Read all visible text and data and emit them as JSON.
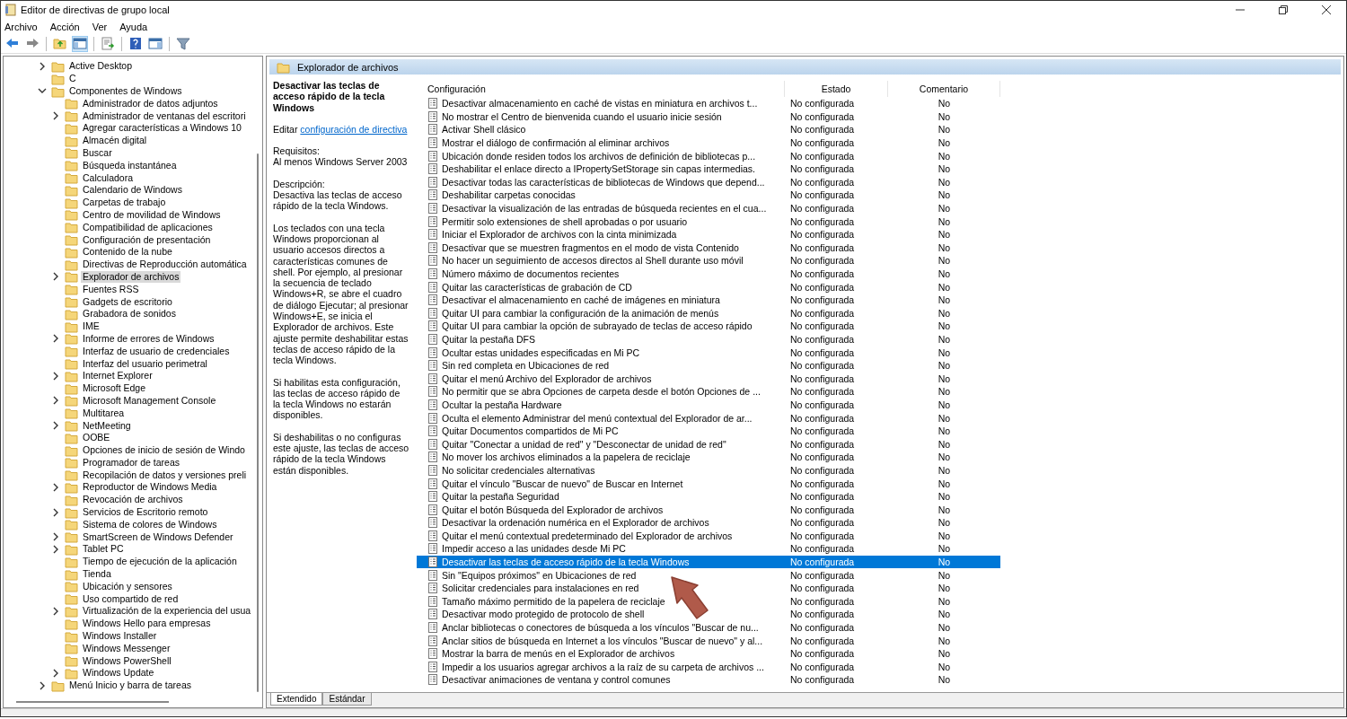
{
  "window": {
    "title": "Editor de directivas de grupo local"
  },
  "menu": [
    "Archivo",
    "Acción",
    "Ver",
    "Ayuda"
  ],
  "tree": [
    {
      "label": "Active Desktop",
      "expanded": false,
      "selected": false
    },
    {
      "label": "C",
      "selected": false
    },
    {
      "label": "Componentes de Windows",
      "expanded": true,
      "selected": false,
      "children": [
        {
          "label": "Administrador de datos adjuntos",
          "selected": false
        },
        {
          "label": "Administrador de ventanas del escritori",
          "expanded": false,
          "selected": false
        },
        {
          "label": "Agregar características a Windows 10",
          "selected": false
        },
        {
          "label": "Almacén digital",
          "selected": false
        },
        {
          "label": "Buscar",
          "selected": false
        },
        {
          "label": "Búsqueda instantánea",
          "selected": false
        },
        {
          "label": "Calculadora",
          "selected": false
        },
        {
          "label": "Calendario de Windows",
          "selected": false
        },
        {
          "label": "Carpetas de trabajo",
          "selected": false
        },
        {
          "label": "Centro de movilidad de Windows",
          "selected": false
        },
        {
          "label": "Compatibilidad de aplicaciones",
          "selected": false
        },
        {
          "label": "Configuración de presentación",
          "selected": false
        },
        {
          "label": "Contenido de la nube",
          "selected": false
        },
        {
          "label": "Directivas de Reproducción automática",
          "selected": false
        },
        {
          "label": "Explorador de archivos",
          "expanded": false,
          "selected": true
        },
        {
          "label": "Fuentes RSS",
          "selected": false
        },
        {
          "label": "Gadgets de escritorio",
          "selected": false
        },
        {
          "label": "Grabadora de sonidos",
          "selected": false
        },
        {
          "label": "IME",
          "selected": false
        },
        {
          "label": "Informe de errores de Windows",
          "expanded": false,
          "selected": false
        },
        {
          "label": "Interfaz de usuario de credenciales",
          "selected": false
        },
        {
          "label": "Interfaz del usuario perimetral",
          "selected": false
        },
        {
          "label": "Internet Explorer",
          "expanded": false,
          "selected": false
        },
        {
          "label": "Microsoft Edge",
          "selected": false
        },
        {
          "label": "Microsoft Management Console",
          "expanded": false,
          "selected": false
        },
        {
          "label": "Multitarea",
          "selected": false
        },
        {
          "label": "NetMeeting",
          "expanded": false,
          "selected": false
        },
        {
          "label": "OOBE",
          "selected": false
        },
        {
          "label": "Opciones de inicio de sesión de Windo",
          "selected": false
        },
        {
          "label": "Programador de tareas",
          "selected": false
        },
        {
          "label": "Recopilación de datos y versiones preli",
          "selected": false
        },
        {
          "label": "Reproductor de Windows Media",
          "expanded": false,
          "selected": false
        },
        {
          "label": "Revocación de archivos",
          "selected": false
        },
        {
          "label": "Servicios de Escritorio remoto",
          "expanded": false,
          "selected": false
        },
        {
          "label": "Sistema de colores de Windows",
          "selected": false
        },
        {
          "label": "SmartScreen de Windows Defender",
          "expanded": false,
          "selected": false
        },
        {
          "label": "Tablet PC",
          "expanded": false,
          "selected": false
        },
        {
          "label": "Tiempo de ejecución de la aplicación",
          "selected": false
        },
        {
          "label": "Tienda",
          "selected": false
        },
        {
          "label": "Ubicación y sensores",
          "selected": false
        },
        {
          "label": "Uso compartido de red",
          "selected": false
        },
        {
          "label": "Virtualización de la experiencia del usua",
          "expanded": false,
          "selected": false
        },
        {
          "label": "Windows Hello para empresas",
          "selected": false
        },
        {
          "label": "Windows Installer",
          "selected": false
        },
        {
          "label": "Windows Messenger",
          "selected": false
        },
        {
          "label": "Windows PowerShell",
          "selected": false
        },
        {
          "label": "Windows Update",
          "expanded": false,
          "selected": false
        }
      ]
    },
    {
      "label": "Menú Inicio y barra de tareas",
      "expanded": false,
      "selected": false
    }
  ],
  "pane_header": "Explorador de archivos",
  "description": {
    "title": "Desactivar las teclas de acceso rápido de la tecla Windows",
    "edit_prefix": "Editar",
    "edit_link": "configuración de directiva",
    "requirements_label": "Requisitos:",
    "requirements": "Al menos Windows Server 2003",
    "description_label": "Descripción:",
    "paragraphs": [
      "Desactiva las teclas de acceso rápido de la tecla Windows.",
      "Los teclados con una tecla Windows proporcionan al usuario accesos directos a características comunes de shell. Por ejemplo, al presionar la secuencia de teclado Windows+R, se abre el cuadro de diálogo Ejecutar; al presionar Windows+E, se inicia el Explorador de archivos. Este ajuste permite deshabilitar estas teclas de acceso rápido de la tecla Windows.",
      "Si habilitas esta configuración, las teclas de acceso rápido de la tecla Windows no estarán disponibles.",
      "Si deshabilitas o no configuras este ajuste, las teclas de acceso rápido de la tecla Windows están disponibles."
    ]
  },
  "table": {
    "columns": [
      "Configuración",
      "Estado",
      "Comentario"
    ],
    "rows": [
      {
        "setting": "Desactivar almacenamiento en caché de vistas en miniatura en archivos t...",
        "state": "No configurada",
        "comment": "No",
        "selected": false
      },
      {
        "setting": "No mostrar el Centro de bienvenida cuando el usuario inicie sesión",
        "state": "No configurada",
        "comment": "No",
        "selected": false
      },
      {
        "setting": "Activar Shell clásico",
        "state": "No configurada",
        "comment": "No",
        "selected": false
      },
      {
        "setting": "Mostrar el diálogo de confirmación al eliminar archivos",
        "state": "No configurada",
        "comment": "No",
        "selected": false
      },
      {
        "setting": "Ubicación donde residen todos los archivos de definición de bibliotecas p...",
        "state": "No configurada",
        "comment": "No",
        "selected": false
      },
      {
        "setting": "Deshabilitar el enlace directo a IPropertySetStorage sin capas intermedias.",
        "state": "No configurada",
        "comment": "No",
        "selected": false
      },
      {
        "setting": "Desactivar todas las características de bibliotecas de Windows que depend...",
        "state": "No configurada",
        "comment": "No",
        "selected": false
      },
      {
        "setting": "Deshabilitar carpetas conocidas",
        "state": "No configurada",
        "comment": "No",
        "selected": false
      },
      {
        "setting": "Desactivar la visualización de las entradas de búsqueda recientes en el cua...",
        "state": "No configurada",
        "comment": "No",
        "selected": false
      },
      {
        "setting": "Permitir solo extensiones de shell aprobadas o por usuario",
        "state": "No configurada",
        "comment": "No",
        "selected": false
      },
      {
        "setting": "Iniciar el Explorador de archivos con la cinta minimizada",
        "state": "No configurada",
        "comment": "No",
        "selected": false
      },
      {
        "setting": "Desactivar que se muestren fragmentos en el modo de vista Contenido",
        "state": "No configurada",
        "comment": "No",
        "selected": false
      },
      {
        "setting": "No hacer un seguimiento de accesos directos al Shell durante uso móvil",
        "state": "No configurada",
        "comment": "No",
        "selected": false
      },
      {
        "setting": "Número máximo de documentos recientes",
        "state": "No configurada",
        "comment": "No",
        "selected": false
      },
      {
        "setting": "Quitar las características de grabación de CD",
        "state": "No configurada",
        "comment": "No",
        "selected": false
      },
      {
        "setting": "Desactivar el almacenamiento en caché de imágenes en miniatura",
        "state": "No configurada",
        "comment": "No",
        "selected": false
      },
      {
        "setting": "Quitar UI para cambiar la configuración de la animación de menús",
        "state": "No configurada",
        "comment": "No",
        "selected": false
      },
      {
        "setting": "Quitar UI para cambiar la opción de subrayado de teclas de acceso rápido",
        "state": "No configurada",
        "comment": "No",
        "selected": false
      },
      {
        "setting": "Quitar la pestaña DFS",
        "state": "No configurada",
        "comment": "No",
        "selected": false
      },
      {
        "setting": "Ocultar estas unidades especificadas en Mi PC",
        "state": "No configurada",
        "comment": "No",
        "selected": false
      },
      {
        "setting": "Sin red completa en Ubicaciones de red",
        "state": "No configurada",
        "comment": "No",
        "selected": false
      },
      {
        "setting": "Quitar el menú Archivo del Explorador de archivos",
        "state": "No configurada",
        "comment": "No",
        "selected": false
      },
      {
        "setting": "No permitir que se abra Opciones de carpeta desde el botón Opciones de ...",
        "state": "No configurada",
        "comment": "No",
        "selected": false
      },
      {
        "setting": "Ocultar la pestaña Hardware",
        "state": "No configurada",
        "comment": "No",
        "selected": false
      },
      {
        "setting": "Oculta el elemento Administrar del menú contextual del Explorador de ar...",
        "state": "No configurada",
        "comment": "No",
        "selected": false
      },
      {
        "setting": "Quitar Documentos compartidos de Mi PC",
        "state": "No configurada",
        "comment": "No",
        "selected": false
      },
      {
        "setting": "Quitar \"Conectar a unidad de red\" y \"Desconectar de unidad de red\"",
        "state": "No configurada",
        "comment": "No",
        "selected": false
      },
      {
        "setting": "No mover los archivos eliminados a la papelera de reciclaje",
        "state": "No configurada",
        "comment": "No",
        "selected": false
      },
      {
        "setting": "No solicitar credenciales alternativas",
        "state": "No configurada",
        "comment": "No",
        "selected": false
      },
      {
        "setting": "Quitar el vínculo \"Buscar de nuevo\" de Buscar en Internet",
        "state": "No configurada",
        "comment": "No",
        "selected": false
      },
      {
        "setting": "Quitar la pestaña Seguridad",
        "state": "No configurada",
        "comment": "No",
        "selected": false
      },
      {
        "setting": "Quitar el botón Búsqueda del Explorador de archivos",
        "state": "No configurada",
        "comment": "No",
        "selected": false
      },
      {
        "setting": "Desactivar la ordenación numérica en el Explorador de archivos",
        "state": "No configurada",
        "comment": "No",
        "selected": false
      },
      {
        "setting": "Quitar el menú contextual predeterminado del Explorador de archivos",
        "state": "No configurada",
        "comment": "No",
        "selected": false
      },
      {
        "setting": "Impedir acceso a las unidades desde Mi PC",
        "state": "No configurada",
        "comment": "No",
        "selected": false
      },
      {
        "setting": "Desactivar las teclas de acceso rápido de la tecla Windows",
        "state": "No configurada",
        "comment": "No",
        "selected": true
      },
      {
        "setting": "Sin \"Equipos próximos\" en Ubicaciones de red",
        "state": "No configurada",
        "comment": "No",
        "selected": false
      },
      {
        "setting": "Solicitar credenciales para instalaciones en red",
        "state": "No configurada",
        "comment": "No",
        "selected": false
      },
      {
        "setting": "Tamaño máximo permitido de la papelera de reciclaje",
        "state": "No configurada",
        "comment": "No",
        "selected": false
      },
      {
        "setting": "Desactivar modo protegido de protocolo de shell",
        "state": "No configurada",
        "comment": "No",
        "selected": false
      },
      {
        "setting": "Anclar bibliotecas o conectores de búsqueda a los vínculos \"Buscar de nu...",
        "state": "No configurada",
        "comment": "No",
        "selected": false
      },
      {
        "setting": "Anclar sitios de búsqueda en Internet a los vínculos \"Buscar de nuevo\" y al...",
        "state": "No configurada",
        "comment": "No",
        "selected": false
      },
      {
        "setting": "Mostrar la barra de menús en el Explorador de archivos",
        "state": "No configurada",
        "comment": "No",
        "selected": false
      },
      {
        "setting": "Impedir a los usuarios agregar archivos a la raíz de su carpeta de archivos ...",
        "state": "No configurada",
        "comment": "No",
        "selected": false
      },
      {
        "setting": "Desactivar animaciones de ventana y control comunes",
        "state": "No configurada",
        "comment": "No",
        "selected": false
      }
    ]
  },
  "view_tabs": [
    {
      "label": "Extendido",
      "selected": true
    },
    {
      "label": "Estándar",
      "selected": false
    }
  ]
}
